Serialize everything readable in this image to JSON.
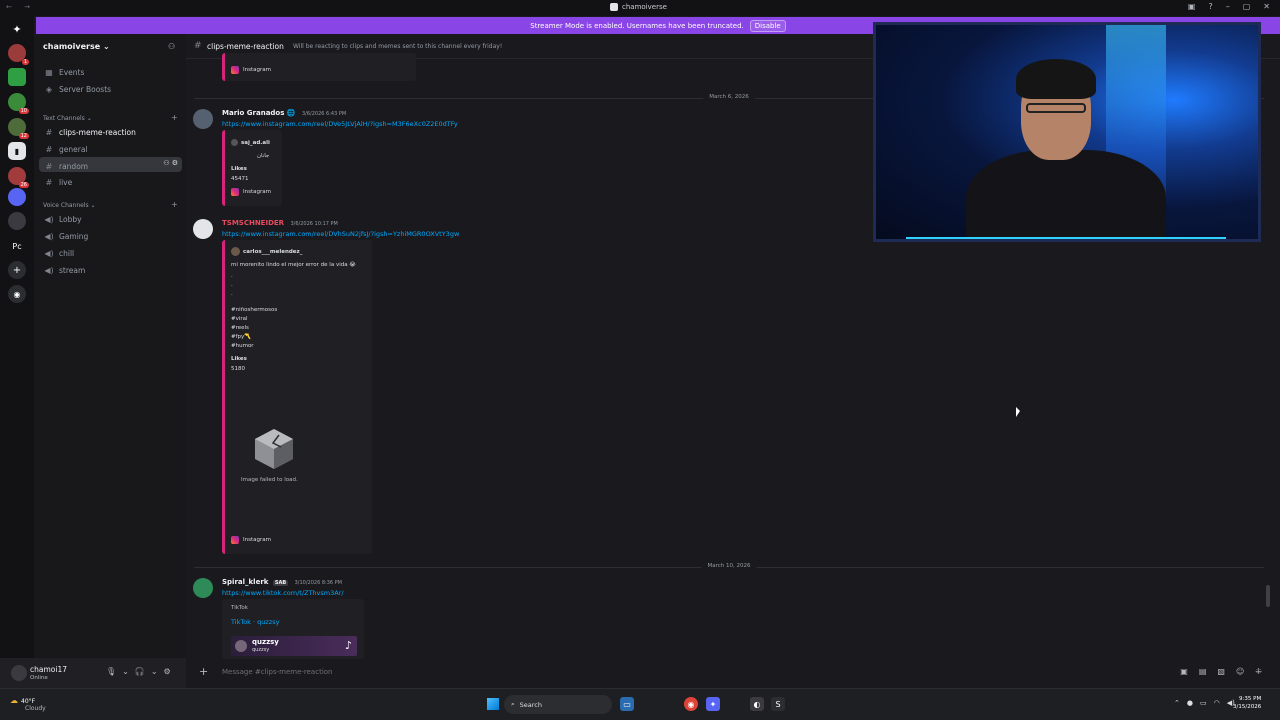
{
  "window": {
    "title": "chamoiverse"
  },
  "banner": {
    "text": "Streamer Mode is enabled. Usernames have been truncated.",
    "disable_label": "Disable"
  },
  "guilds": [
    {
      "name": "discord-home-icon",
      "glyph": "✦",
      "color": "#121214",
      "badge": ""
    },
    {
      "name": "guild-1",
      "glyph": "",
      "color": "#9c3b3b",
      "badge": "1"
    },
    {
      "name": "guild-2",
      "glyph": "",
      "color": "#2ea043",
      "badge": ""
    },
    {
      "name": "guild-3",
      "glyph": "",
      "color": "#3a8b3a",
      "badge": "10"
    },
    {
      "name": "guild-4",
      "glyph": "",
      "color": "#4e6b3a",
      "badge": "12"
    },
    {
      "name": "guild-5",
      "glyph": "",
      "color": "#e3e5e8",
      "badge": ""
    },
    {
      "name": "guild-6",
      "glyph": "",
      "color": "#a23b3b",
      "badge": "26"
    },
    {
      "name": "guild-7",
      "glyph": "",
      "color": "#5865f2",
      "badge": ""
    },
    {
      "name": "guild-8",
      "glyph": "",
      "color": "#3a3a40",
      "badge": ""
    },
    {
      "name": "guild-pc",
      "glyph": "Pc",
      "color": "#121214",
      "badge": ""
    },
    {
      "name": "add-server-icon",
      "glyph": "+",
      "color": "#2b2d31",
      "badge": ""
    },
    {
      "name": "discover-icon",
      "glyph": "◉",
      "color": "#2b2d31",
      "badge": ""
    }
  ],
  "sidebar": {
    "server_name": "chamoiverse ⌄",
    "events": "Events",
    "boosts": "Server Boosts",
    "text_category": "Text Channels ⌄",
    "text_channels": [
      "clips-meme-reaction",
      "general",
      "random",
      "live"
    ],
    "voice_category": "Voice Channels ⌄",
    "voice_channels": [
      "Lobby",
      "Gaming",
      "chill",
      "stream"
    ]
  },
  "user": {
    "name": "chamoi17",
    "status": "Online"
  },
  "channel": {
    "name": "clips-meme-reaction",
    "topic": "Will be reacting to clips and memes sent to this channel every friday!"
  },
  "messages": {
    "top_embed": {
      "provider": "Instagram"
    },
    "date1": "March 6, 2026",
    "m1": {
      "author": "Mario Granados",
      "badge": "🌐",
      "timestamp": "3/6/2026 6:43 PM",
      "link": "https://www.instagram.com/reel/DVe5JLVjAlH/?igsh=M3F6eXc0Z2E0dTFy",
      "embed_user": "saj_ad.ali",
      "embed_text": "جانان",
      "likes_label": "Likes",
      "likes": "45471",
      "provider": "Instagram"
    },
    "m2": {
      "author": "TSMSCHNEIDER",
      "timestamp": "3/6/2026 10:17 PM",
      "link": "https://www.instagram.com/reel/DVhSuN2jfsJ/?igsh=YzhiMGR0OXVtY3gw",
      "embed_user": "carlos___melendez_",
      "caption": "mi morenito lindo el mejor error de la vida 😭",
      "dots": [
        ".",
        ".",
        "."
      ],
      "tags": [
        "#niñoshermosos",
        "#viral",
        "#reels",
        "#fpy〽️",
        "#humor"
      ],
      "likes_label": "Likes",
      "likes": "5180",
      "image_error": "Image failed to load.",
      "provider": "Instagram"
    },
    "date2": "March 10, 2026",
    "m3": {
      "author": "Spiral_klerk",
      "tag": "SAB",
      "timestamp": "3/10/2026 8:36 PM",
      "link": "https://www.tiktok.com/t/ZThvsm3Ar/",
      "embed_provider": "TikTok",
      "embed_title": "TikTok · quzzsy",
      "preview_title": "quzzsy",
      "preview_sub": "quzzsy"
    }
  },
  "input": {
    "placeholder": "Message #clips-meme-reaction"
  },
  "taskbar": {
    "temp": "40°F",
    "condition": "Cloudy",
    "search": "Search",
    "time": "9:35 PM",
    "date": "3/15/2026"
  },
  "colors": {
    "accent": "#8a45e6",
    "link": "#00a8fc",
    "instagram": "#d6247a"
  }
}
